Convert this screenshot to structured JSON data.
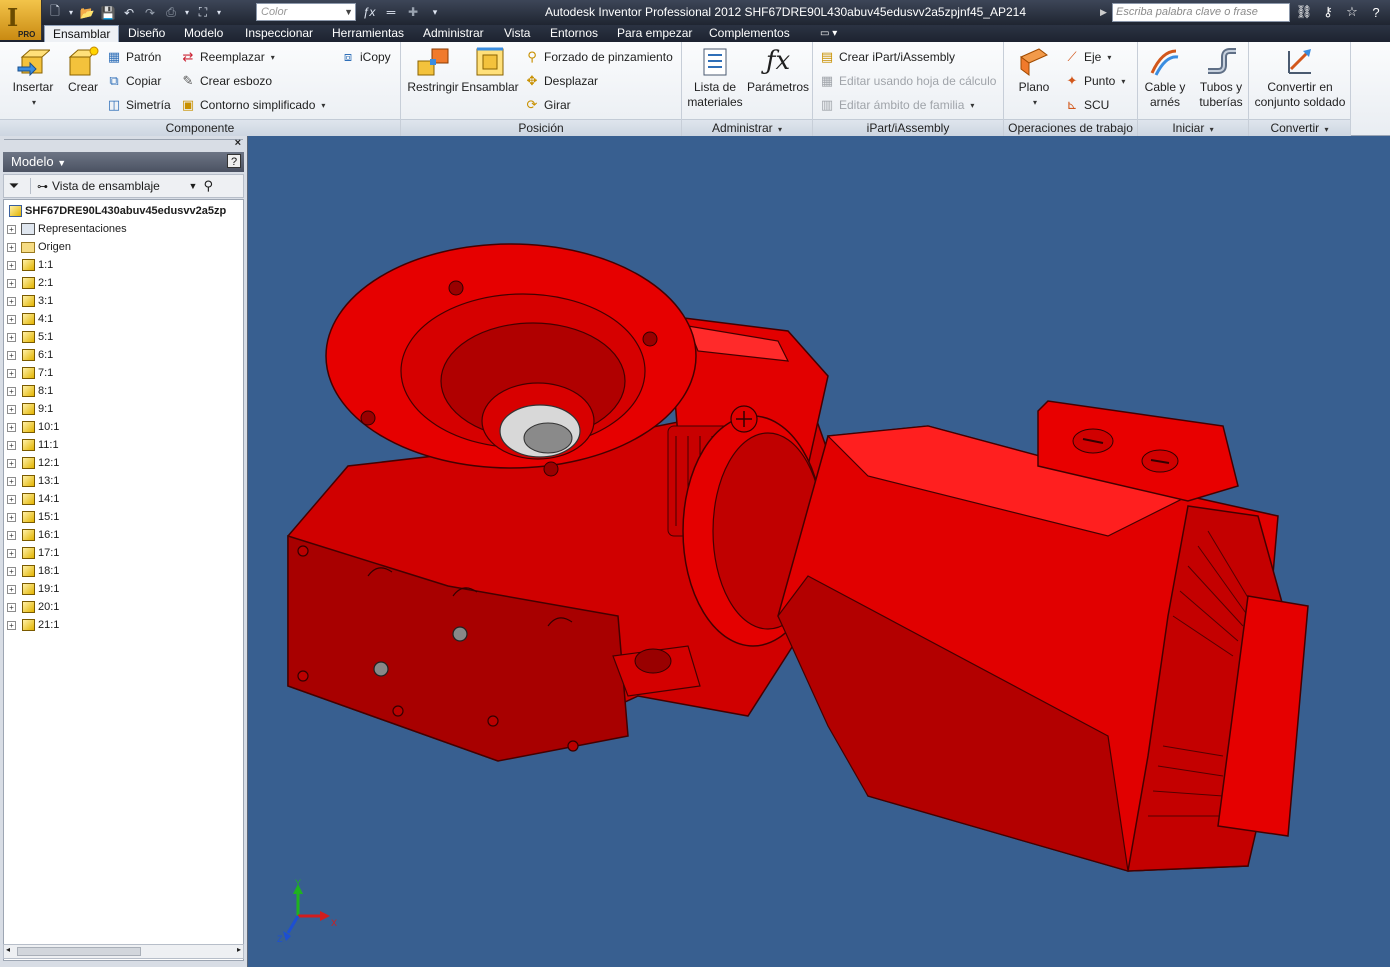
{
  "app": {
    "logo_label": "PRO",
    "window_title": "Autodesk Inventor Professional 2012   SHF67DRE90L430abuv45edusvv2a5zpjnf45_AP214",
    "color_combo": "Color",
    "search_placeholder": "Escriba palabra clave o frase"
  },
  "tabs": [
    "Ensamblar",
    "Diseño",
    "Modelo",
    "Inspeccionar",
    "Herramientas",
    "Administrar",
    "Vista",
    "Entornos",
    "Para empezar",
    "Complementos"
  ],
  "ribbon": {
    "componente": {
      "title": "Componente",
      "insertar": "Insertar",
      "crear": "Crear",
      "patron": "Patrón",
      "copiar": "Copiar",
      "simetria": "Simetría",
      "reemplazar": "Reemplazar",
      "crear_esbozo": "Crear esbozo",
      "contorno_simplificado": "Contorno simplificado",
      "icopy": "iCopy"
    },
    "posicion": {
      "title": "Posición",
      "restringir": "Restringir",
      "ensamblar": "Ensamblar",
      "forzado": "Forzado de pinzamiento",
      "desplazar": "Desplazar",
      "girar": "Girar"
    },
    "administrar": {
      "title": "Administrar",
      "lista_1": "Lista de",
      "lista_2": "materiales",
      "parametros": "Parámetros"
    },
    "ipart": {
      "title": "iPart/iAssembly",
      "crear": "Crear iPart/iAssembly",
      "editar_hoja": "Editar usando hoja de cálculo",
      "editar_ambito": "Editar ámbito de familia"
    },
    "operaciones": {
      "title": "Operaciones de trabajo",
      "plano": "Plano",
      "eje": "Eje",
      "punto": "Punto",
      "scu": "SCU"
    },
    "iniciar": {
      "title": "Iniciar",
      "cable_1": "Cable y",
      "cable_2": "arnés",
      "tubos_1": "Tubos y",
      "tubos_2": "tuberías"
    },
    "convertir": {
      "title": "Convertir",
      "conv_1": "Convertir en",
      "conv_2": "conjunto soldado"
    }
  },
  "browser": {
    "title": "Modelo",
    "view": "Vista de ensamblaje",
    "root": "SHF67DRE90L430abuv45edusvv2a5zp",
    "items": [
      "Representaciones",
      "Origen",
      "1:1",
      "2:1",
      "3:1",
      "4:1",
      "5:1",
      "6:1",
      "7:1",
      "8:1",
      "9:1",
      "10:1",
      "11:1",
      "12:1",
      "13:1",
      "14:1",
      "15:1",
      "16:1",
      "17:1",
      "18:1",
      "19:1",
      "20:1",
      "21:1"
    ]
  },
  "viewport": {
    "background": "#385f90",
    "part_color": "#e00000",
    "axis_labels": {
      "x": "X",
      "y": "Y",
      "z": "Z"
    }
  }
}
